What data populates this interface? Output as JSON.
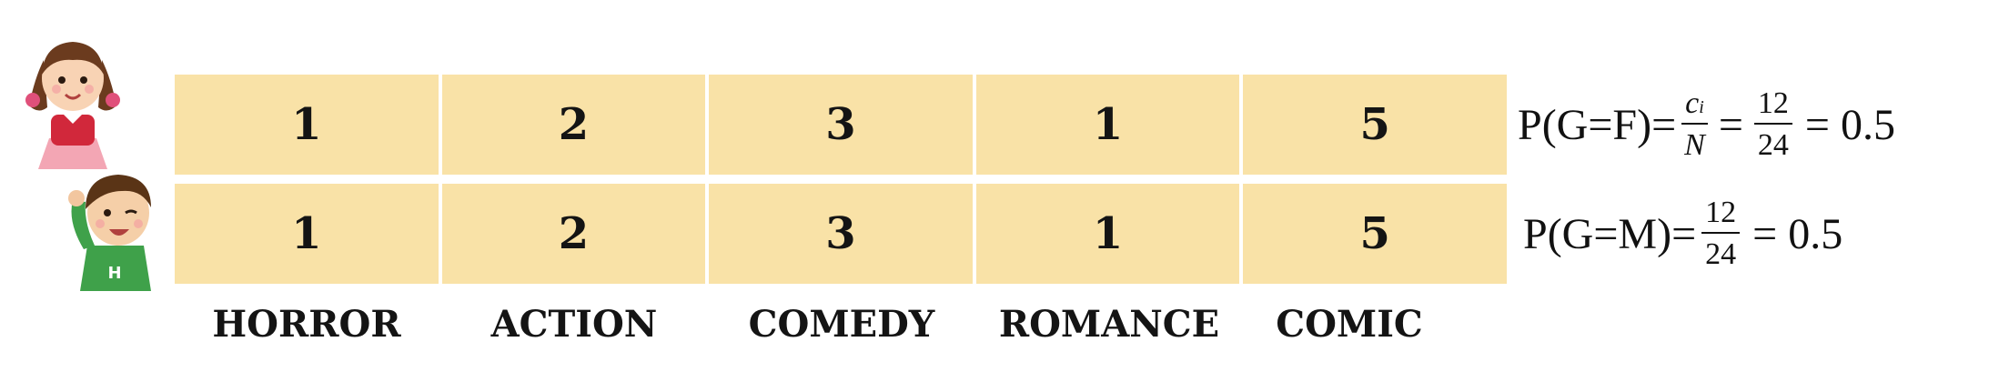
{
  "rows": [
    {
      "gender": "female",
      "values": [
        "1",
        "2",
        "3",
        "1",
        "5"
      ]
    },
    {
      "gender": "male",
      "values": [
        "1",
        "2",
        "3",
        "1",
        "5"
      ]
    }
  ],
  "genres": [
    "HORROR",
    "ACTION",
    "COMEDY",
    "ROMANCE",
    "COMIC"
  ],
  "formula_female": {
    "lhs": "P(G=F)=",
    "c": "c",
    "sub": "i",
    "N": "N",
    "eq": "=",
    "num": "12",
    "den": "24",
    "result": "= 0.5"
  },
  "formula_male": {
    "lhs": "P(G=M)=",
    "num": "12",
    "den": "24",
    "result": "= 0.5"
  },
  "colors": {
    "cell": "#f9e2a7",
    "text": "#141414"
  },
  "icons": {
    "female": "girl-avatar-icon",
    "male": "boy-avatar-icon"
  }
}
